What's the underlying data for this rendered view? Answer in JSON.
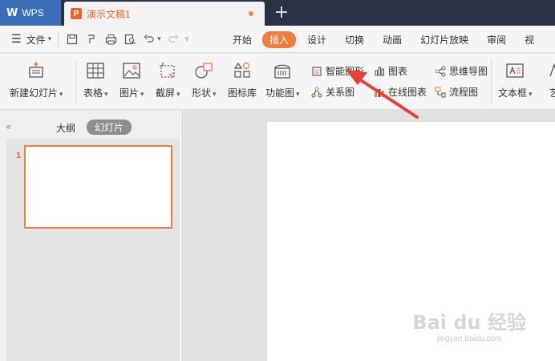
{
  "titlebar": {
    "app_name": "WPS",
    "doc_icon_letter": "P",
    "doc_title": "演示文稿1"
  },
  "menubar": {
    "file_label": "文件",
    "tabs": [
      "开始",
      "插入",
      "设计",
      "切换",
      "动画",
      "幻灯片放映",
      "审阅",
      "视"
    ],
    "active_tab": "插入"
  },
  "ribbon": {
    "new_slide": "新建幻灯片",
    "table": "表格",
    "picture": "图片",
    "screenshot": "截屏",
    "shape": "形状",
    "icon_library": "图标库",
    "function_chart": "功能图",
    "smart_art": "智能图形",
    "relation_chart": "关系图",
    "chart": "图表",
    "online_chart": "在线图表",
    "mind_map": "思维导图",
    "flowchart": "流程图",
    "text_box": "文本框",
    "art_text": "艺"
  },
  "left_panel": {
    "collapse_icon": "«",
    "tab_outline": "大纲",
    "tab_slides": "幻灯片",
    "slide_number": "1"
  },
  "watermark": {
    "main": "Bai du 经验",
    "sub": "jingyan.baidu.com"
  },
  "colors": {
    "accent": "#f07d3d",
    "titlebar": "#283244",
    "wps_tab": "#3a6fb8",
    "annotation_arrow": "#e8403a"
  }
}
